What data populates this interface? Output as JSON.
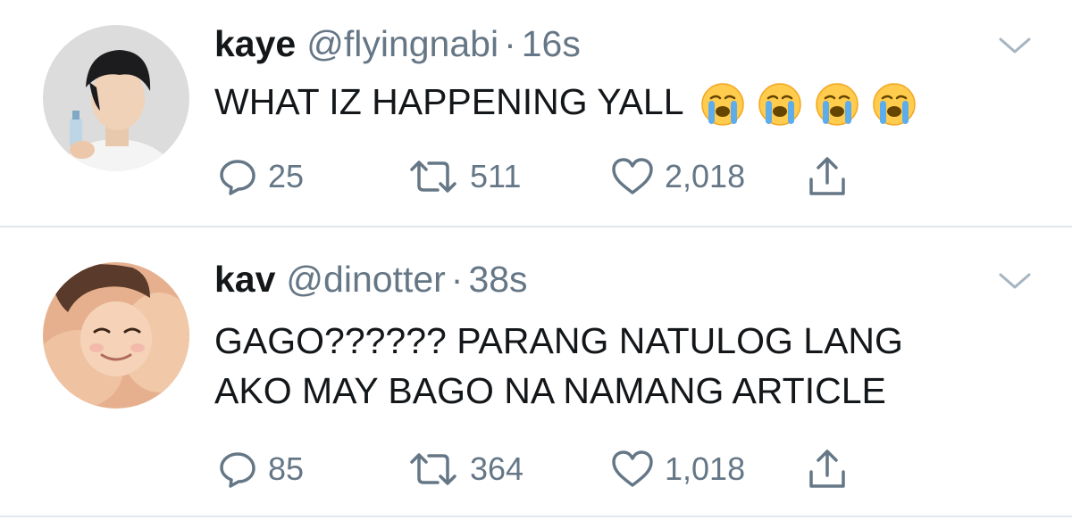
{
  "tweets": [
    {
      "display_name": "kaye",
      "handle": "@flyingnabi",
      "separator": "·",
      "time": "16s",
      "text_lines": [
        "WHAT IZ HAPPENING YALL"
      ],
      "emojis": [
        "crying-face-emoji",
        "crying-face-emoji",
        "crying-face-emoji",
        "crying-face-emoji"
      ],
      "replies": "25",
      "retweets": "511",
      "likes": "2,018"
    },
    {
      "display_name": "kav",
      "handle": "@dinotter",
      "separator": "·",
      "time": "38s",
      "text_lines": [
        "GAGO?????? PARANG NATULOG LANG",
        "AKO MAY BAGO NA NAMANG ARTICLE"
      ],
      "emojis": [],
      "replies": "85",
      "retweets": "364",
      "likes": "1,018"
    }
  ],
  "icons": {
    "reply": "reply-icon",
    "retweet": "retweet-icon",
    "like": "heart-icon",
    "share": "share-icon",
    "menu": "chevron-down-icon"
  },
  "colors": {
    "text": "#14171a",
    "secondary": "#657786",
    "divider": "#e1e8ed",
    "emoji_face": "#ffcc4d",
    "emoji_tears": "#5dadec"
  }
}
